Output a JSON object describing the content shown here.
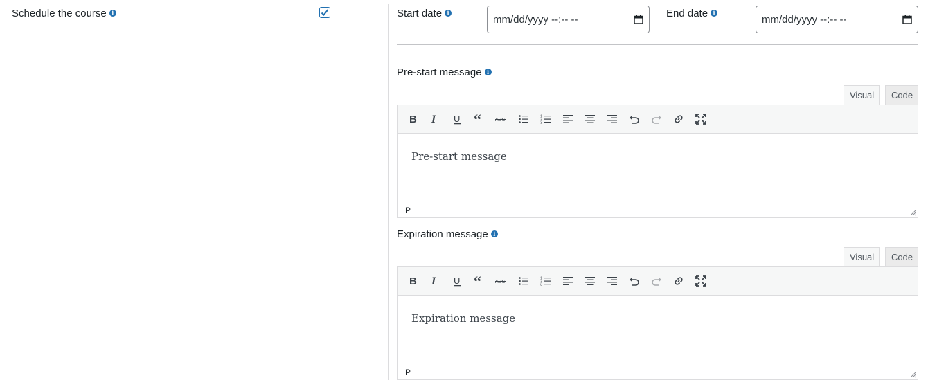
{
  "schedule": {
    "label": "Schedule the course",
    "checked": true
  },
  "start_date": {
    "label": "Start date",
    "placeholder": "mm/dd/yyyy --:-- --"
  },
  "end_date": {
    "label": "End date",
    "placeholder": "mm/dd/yyyy --:-- --"
  },
  "pre_start": {
    "label": "Pre-start message",
    "tab_visual": "Visual",
    "tab_code": "Code",
    "content": "Pre-start message",
    "path": "P"
  },
  "expiration": {
    "label": "Expiration message",
    "tab_visual": "Visual",
    "tab_code": "Code",
    "content": "Expiration message",
    "path": "P"
  },
  "toolbar_icons": [
    "bold-icon",
    "italic-icon",
    "underline-icon",
    "blockquote-icon",
    "strikethrough-icon",
    "bullet-list-icon",
    "numbered-list-icon",
    "align-left-icon",
    "align-center-icon",
    "align-right-icon",
    "undo-icon",
    "redo-icon",
    "link-icon",
    "fullscreen-icon"
  ],
  "colors": {
    "accent": "#2271b1",
    "border": "#dcdcde",
    "toolbar_bg": "#f6f7f7"
  }
}
